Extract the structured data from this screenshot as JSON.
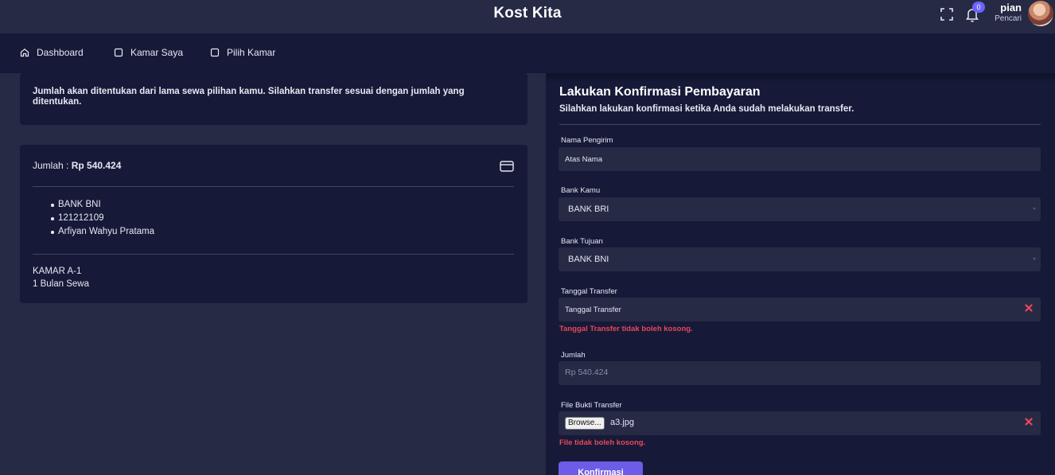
{
  "header": {
    "app_title": "Kost Kita",
    "notification_count": "0",
    "user_name": "pian",
    "user_role": "Pencari"
  },
  "nav": {
    "items": [
      {
        "label": "Dashboard",
        "icon": "home-icon"
      },
      {
        "label": "Kamar Saya",
        "icon": "square-icon"
      },
      {
        "label": "Pilih Kamar",
        "icon": "square-icon"
      }
    ]
  },
  "info": {
    "text": "Jumlah akan ditentukan dari lama sewa pilihan kamu. Silahkan transfer sesuai dengan jumlah yang ditentukan."
  },
  "payment": {
    "amount_label": "Jumlah : ",
    "amount_value": "Rp 540.424",
    "bank_details": [
      "BANK BNI",
      "121212109",
      "Arfiyan Wahyu Pratama"
    ],
    "room": "KAMAR A-1",
    "duration": "1 Bulan Sewa"
  },
  "form": {
    "title": "Lakukan Konfirmasi Pembayaran",
    "subtitle": "Silahkan lakukan konfirmasi ketika Anda sudah melakukan transfer.",
    "sender_label": "Nama Pengirim",
    "sender_placeholder": "Atas Nama",
    "bank_from_label": "Bank Kamu",
    "bank_from_value": "BANK BRI",
    "bank_to_label": "Bank Tujuan",
    "bank_to_value": "BANK BNI",
    "date_label": "Tanggal Transfer",
    "date_placeholder": "Tanggal Transfer",
    "date_error": "Tanggal Transfer tidak boleh kosong.",
    "amount_label": "Jumlah",
    "amount_value": "Rp 540.424",
    "file_label": "File Bukti Transfer",
    "browse_label": "Browse...",
    "file_name": "a3.jpg",
    "file_error": "File tidak boleh kosong.",
    "submit_label": "Konfirmasi"
  },
  "colors": {
    "background": "#262a45",
    "panel": "#161a38",
    "accent": "#6c5ce7",
    "error": "#e8485a"
  }
}
